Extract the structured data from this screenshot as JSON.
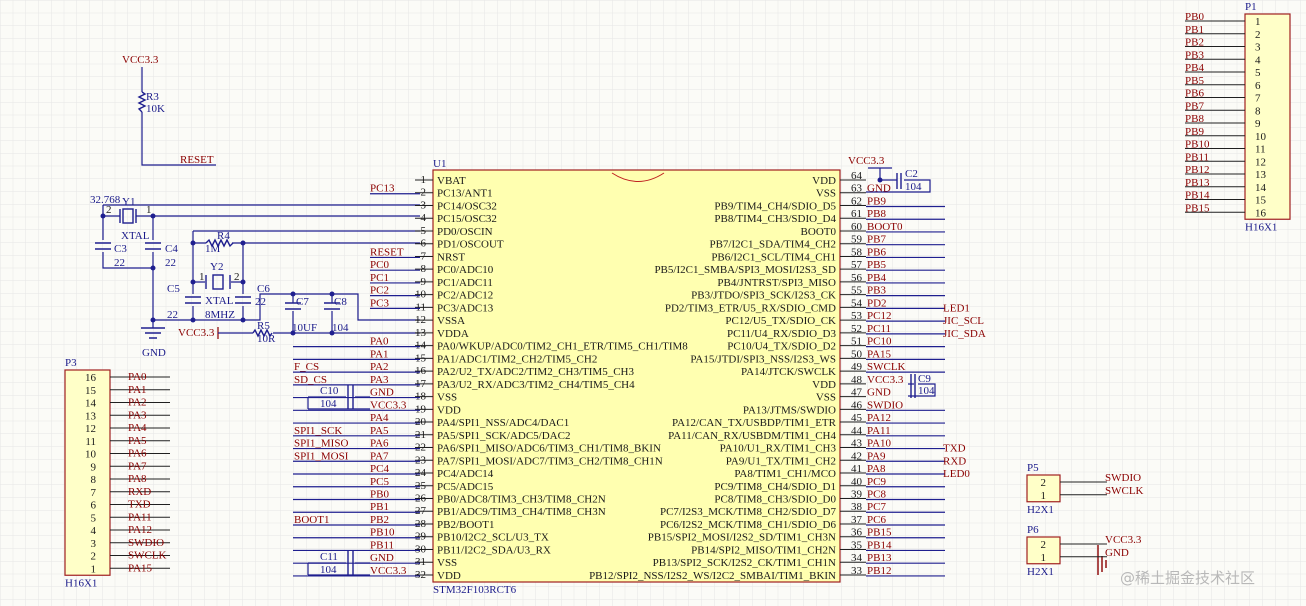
{
  "u1": {
    "designator": "U1",
    "part": "STM32F103RCT6",
    "left_pins": [
      {
        "n": "1",
        "name": "VBAT",
        "net": "",
        "ext": ""
      },
      {
        "n": "2",
        "name": "PC13/ANT1",
        "net": "PC13",
        "ext": ""
      },
      {
        "n": "3",
        "name": "PC14/OSC32",
        "net": "",
        "ext": ""
      },
      {
        "n": "4",
        "name": "PC15/OSC32",
        "net": "",
        "ext": ""
      },
      {
        "n": "5",
        "name": "PD0/OSCIN",
        "net": "",
        "ext": ""
      },
      {
        "n": "6",
        "name": "PD1/OSCOUT",
        "net": "",
        "ext": ""
      },
      {
        "n": "7",
        "name": "NRST",
        "net": "RESET",
        "ext": ""
      },
      {
        "n": "8",
        "name": "PC0/ADC10",
        "net": "PC0",
        "ext": ""
      },
      {
        "n": "9",
        "name": "PC1/ADC11",
        "net": "PC1",
        "ext": ""
      },
      {
        "n": "10",
        "name": "PC2/ADC12",
        "net": "PC2",
        "ext": ""
      },
      {
        "n": "11",
        "name": "PC3/ADC13",
        "net": "PC3",
        "ext": ""
      },
      {
        "n": "12",
        "name": "VSSA",
        "net": "",
        "ext": ""
      },
      {
        "n": "13",
        "name": "VDDA",
        "net": "",
        "ext": ""
      },
      {
        "n": "14",
        "name": "PA0/WKUP/ADC0/TIM2_CH1_ETR/TIM5_CH1/TIM8",
        "net": "PA0",
        "ext": ""
      },
      {
        "n": "15",
        "name": "PA1/ADC1/TIM2_CH2/TIM5_CH2",
        "net": "PA1",
        "ext": ""
      },
      {
        "n": "16",
        "name": "PA2/U2_TX/ADC2/TIM2_CH3/TIM5_CH3",
        "net": "PA2",
        "ext": "F_CS"
      },
      {
        "n": "17",
        "name": "PA3/U2_RX/ADC3/TIM2_CH4/TIM5_CH4",
        "net": "PA3",
        "ext": "SD_CS"
      },
      {
        "n": "18",
        "name": "VSS",
        "net": "GND",
        "ext": ""
      },
      {
        "n": "19",
        "name": "VDD",
        "net": "VCC3.3",
        "ext": ""
      },
      {
        "n": "20",
        "name": "PA4/SPI1_NSS/ADC4/DAC1",
        "net": "PA4",
        "ext": ""
      },
      {
        "n": "21",
        "name": "PA5/SPI1_SCK/ADC5/DAC2",
        "net": "PA5",
        "ext": "SPI1_SCK"
      },
      {
        "n": "22",
        "name": "PA6/SPI1_MISO/ADC6/TIM3_CH1/TIM8_BKIN",
        "net": "PA6",
        "ext": "SPI1_MISO"
      },
      {
        "n": "23",
        "name": "PA7/SPI1_MOSI/ADC7/TIM3_CH2/TIM8_CH1N",
        "net": "PA7",
        "ext": "SPI1_MOSI"
      },
      {
        "n": "24",
        "name": "PC4/ADC14",
        "net": "PC4",
        "ext": ""
      },
      {
        "n": "25",
        "name": "PC5/ADC15",
        "net": "PC5",
        "ext": ""
      },
      {
        "n": "26",
        "name": "PB0/ADC8/TIM3_CH3/TIM8_CH2N",
        "net": "PB0",
        "ext": ""
      },
      {
        "n": "27",
        "name": "PB1/ADC9/TIM3_CH4/TIM8_CH3N",
        "net": "PB1",
        "ext": ""
      },
      {
        "n": "28",
        "name": "PB2/BOOT1",
        "net": "PB2",
        "ext": "BOOT1"
      },
      {
        "n": "29",
        "name": "PB10/I2C2_SCL/U3_TX",
        "net": "PB10",
        "ext": ""
      },
      {
        "n": "30",
        "name": "PB11/I2C2_SDA/U3_RX",
        "net": "PB11",
        "ext": ""
      },
      {
        "n": "31",
        "name": "VSS",
        "net": "GND",
        "ext": ""
      },
      {
        "n": "32",
        "name": "VDD",
        "net": "VCC3.3",
        "ext": ""
      }
    ],
    "right_pins": [
      {
        "n": "64",
        "name": "VDD",
        "net": "",
        "ext": ""
      },
      {
        "n": "63",
        "name": "VSS",
        "net": "GND",
        "ext": ""
      },
      {
        "n": "62",
        "name": "PB9/TIM4_CH4/SDIO_D5",
        "net": "PB9",
        "ext": ""
      },
      {
        "n": "61",
        "name": "PB8/TIM4_CH3/SDIO_D4",
        "net": "PB8",
        "ext": ""
      },
      {
        "n": "60",
        "name": "BOOT0",
        "net": "BOOT0",
        "ext": ""
      },
      {
        "n": "59",
        "name": "PB7/I2C1_SDA/TIM4_CH2",
        "net": "PB7",
        "ext": ""
      },
      {
        "n": "58",
        "name": "PB6/I2C1_SCL/TIM4_CH1",
        "net": "PB6",
        "ext": ""
      },
      {
        "n": "57",
        "name": "PB5/I2C1_SMBA/SPI3_MOSI/I2S3_SD",
        "net": "PB5",
        "ext": ""
      },
      {
        "n": "56",
        "name": "PB4/JNTRST/SPI3_MISO",
        "net": "PB4",
        "ext": ""
      },
      {
        "n": "55",
        "name": "PB3/JTDO/SPI3_SCK/I2S3_CK",
        "net": "PB3",
        "ext": ""
      },
      {
        "n": "54",
        "name": "PD2/TIM3_ETR/U5_RX/SDIO_CMD",
        "net": "PD2",
        "ext": "LED1"
      },
      {
        "n": "53",
        "name": "PC12/U5_TX/SDIO_CK",
        "net": "PC12",
        "ext": "JIC_SCL"
      },
      {
        "n": "52",
        "name": "PC11/U4_RX/SDIO_D3",
        "net": "PC11",
        "ext": "JIC_SDA"
      },
      {
        "n": "51",
        "name": "PC10/U4_TX/SDIO_D2",
        "net": "PC10",
        "ext": ""
      },
      {
        "n": "50",
        "name": "PA15/JTDI/SPI3_NSS/I2S3_WS",
        "net": "PA15",
        "ext": ""
      },
      {
        "n": "49",
        "name": "PA14/JTCK/SWCLK",
        "net": "SWCLK",
        "ext": ""
      },
      {
        "n": "48",
        "name": "VDD",
        "net": "VCC3.3",
        "ext": ""
      },
      {
        "n": "47",
        "name": "VSS",
        "net": "GND",
        "ext": ""
      },
      {
        "n": "46",
        "name": "PA13/JTMS/SWDIO",
        "net": "SWDIO",
        "ext": ""
      },
      {
        "n": "45",
        "name": "PA12/CAN_TX/USBDP/TIM1_ETR",
        "net": "PA12",
        "ext": ""
      },
      {
        "n": "44",
        "name": "PA11/CAN_RX/USBDM/TIM1_CH4",
        "net": "PA11",
        "ext": ""
      },
      {
        "n": "43",
        "name": "PA10/U1_RX/TIM1_CH3",
        "net": "PA10",
        "ext": "TXD"
      },
      {
        "n": "42",
        "name": "PA9/U1_TX/TIM1_CH2",
        "net": "PA9",
        "ext": "RXD"
      },
      {
        "n": "41",
        "name": "PA8/TIM1_CH1/MCO",
        "net": "PA8",
        "ext": "LED0"
      },
      {
        "n": "40",
        "name": "PC9/TIM8_CH4/SDIO_D1",
        "net": "PC9",
        "ext": ""
      },
      {
        "n": "39",
        "name": "PC8/TIM8_CH3/SDIO_D0",
        "net": "PC8",
        "ext": ""
      },
      {
        "n": "38",
        "name": "PC7/I2S3_MCK/TIM8_CH2/SDIO_D7",
        "net": "PC7",
        "ext": ""
      },
      {
        "n": "37",
        "name": "PC6/I2S2_MCK/TIM8_CH1/SDIO_D6",
        "net": "PC6",
        "ext": ""
      },
      {
        "n": "36",
        "name": "PB15/SPI2_MOSI/I2S2_SD/TIM1_CH3N",
        "net": "PB15",
        "ext": ""
      },
      {
        "n": "35",
        "name": "PB14/SPI2_MISO/TIM1_CH2N",
        "net": "PB14",
        "ext": ""
      },
      {
        "n": "34",
        "name": "PB13/SPI2_SCK/I2S2_CK/TIM1_CH1N",
        "net": "PB13",
        "ext": ""
      },
      {
        "n": "33",
        "name": "PB12/SPI2_NSS/I2S2_WS/I2C2_SMBAI/TIM1_BKIN",
        "net": "PB12",
        "ext": ""
      }
    ]
  },
  "p1": {
    "designator": "P1",
    "part": "H16X1",
    "pins": [
      {
        "n": "1",
        "net": "PB0"
      },
      {
        "n": "2",
        "net": "PB1"
      },
      {
        "n": "3",
        "net": "PB2"
      },
      {
        "n": "4",
        "net": "PB3"
      },
      {
        "n": "5",
        "net": "PB4"
      },
      {
        "n": "6",
        "net": "PB5"
      },
      {
        "n": "7",
        "net": "PB6"
      },
      {
        "n": "8",
        "net": "PB7"
      },
      {
        "n": "9",
        "net": "PB8"
      },
      {
        "n": "10",
        "net": "PB9"
      },
      {
        "n": "11",
        "net": "PB10"
      },
      {
        "n": "12",
        "net": "PB11"
      },
      {
        "n": "13",
        "net": "PB12"
      },
      {
        "n": "14",
        "net": "PB13"
      },
      {
        "n": "15",
        "net": "PB14"
      },
      {
        "n": "16",
        "net": "PB15"
      }
    ]
  },
  "p3": {
    "designator": "P3",
    "part": "H16X1",
    "pins": [
      {
        "n": "16",
        "net": "PA0"
      },
      {
        "n": "15",
        "net": "PA1"
      },
      {
        "n": "14",
        "net": "PA2"
      },
      {
        "n": "13",
        "net": "PA3"
      },
      {
        "n": "12",
        "net": "PA4"
      },
      {
        "n": "11",
        "net": "PA5"
      },
      {
        "n": "10",
        "net": "PA6"
      },
      {
        "n": "9",
        "net": "PA7"
      },
      {
        "n": "8",
        "net": "PA8"
      },
      {
        "n": "7",
        "net": "RXD"
      },
      {
        "n": "6",
        "net": "TXD"
      },
      {
        "n": "5",
        "net": "PA11"
      },
      {
        "n": "4",
        "net": "PA12"
      },
      {
        "n": "3",
        "net": "SWDIO"
      },
      {
        "n": "2",
        "net": "SWCLK"
      },
      {
        "n": "1",
        "net": "PA15"
      }
    ]
  },
  "p5": {
    "designator": "P5",
    "part": "H2X1",
    "pins": [
      {
        "n": "2",
        "net": "SWDIO"
      },
      {
        "n": "1",
        "net": "SWCLK"
      }
    ]
  },
  "p6": {
    "designator": "P6",
    "part": "H2X1",
    "pins": [
      {
        "n": "2",
        "net": "VCC3.3"
      },
      {
        "n": "1",
        "net": "GND"
      }
    ]
  },
  "reset": {
    "vcc": "VCC3.3",
    "r_des": "R3",
    "r_val": "10K",
    "net": "RESET"
  },
  "osc32": {
    "freq": "32.768",
    "y_des": "Y1",
    "y_type": "XTAL",
    "pin2": "2",
    "pin1": "1",
    "c3": "C3",
    "c3v": "22",
    "c4": "C4",
    "c4v": "22",
    "gnd": "GND"
  },
  "osc8": {
    "r_des": "R4",
    "r_val": "1M",
    "y_des": "Y2",
    "y_type": "XTAL",
    "freq": "8MHZ",
    "pin1": "1",
    "pin2": "2",
    "c5": "C5",
    "c5v": "22",
    "c6": "C6",
    "c6v": "22"
  },
  "vdda": {
    "vcc": "VCC3.3",
    "r_des": "R5",
    "r_val": "10R",
    "c7": "C7",
    "c7v": "10UF",
    "c8": "C8",
    "c8v": "104"
  },
  "decoupling": {
    "vcc_top": "VCC3.3",
    "c2": "C2",
    "c2v": "104",
    "c9": "C9",
    "c9v": "104",
    "c10": "C10",
    "c10v": "104",
    "c11": "C11",
    "c11v": "104"
  },
  "watermark": "@稀土掘金技术社区",
  "colors": {
    "wire": "#1f1f8f",
    "net": "#8b0000",
    "body": "#ffffb0",
    "body_border": "#a02020",
    "grid": "#e6e6e6"
  }
}
